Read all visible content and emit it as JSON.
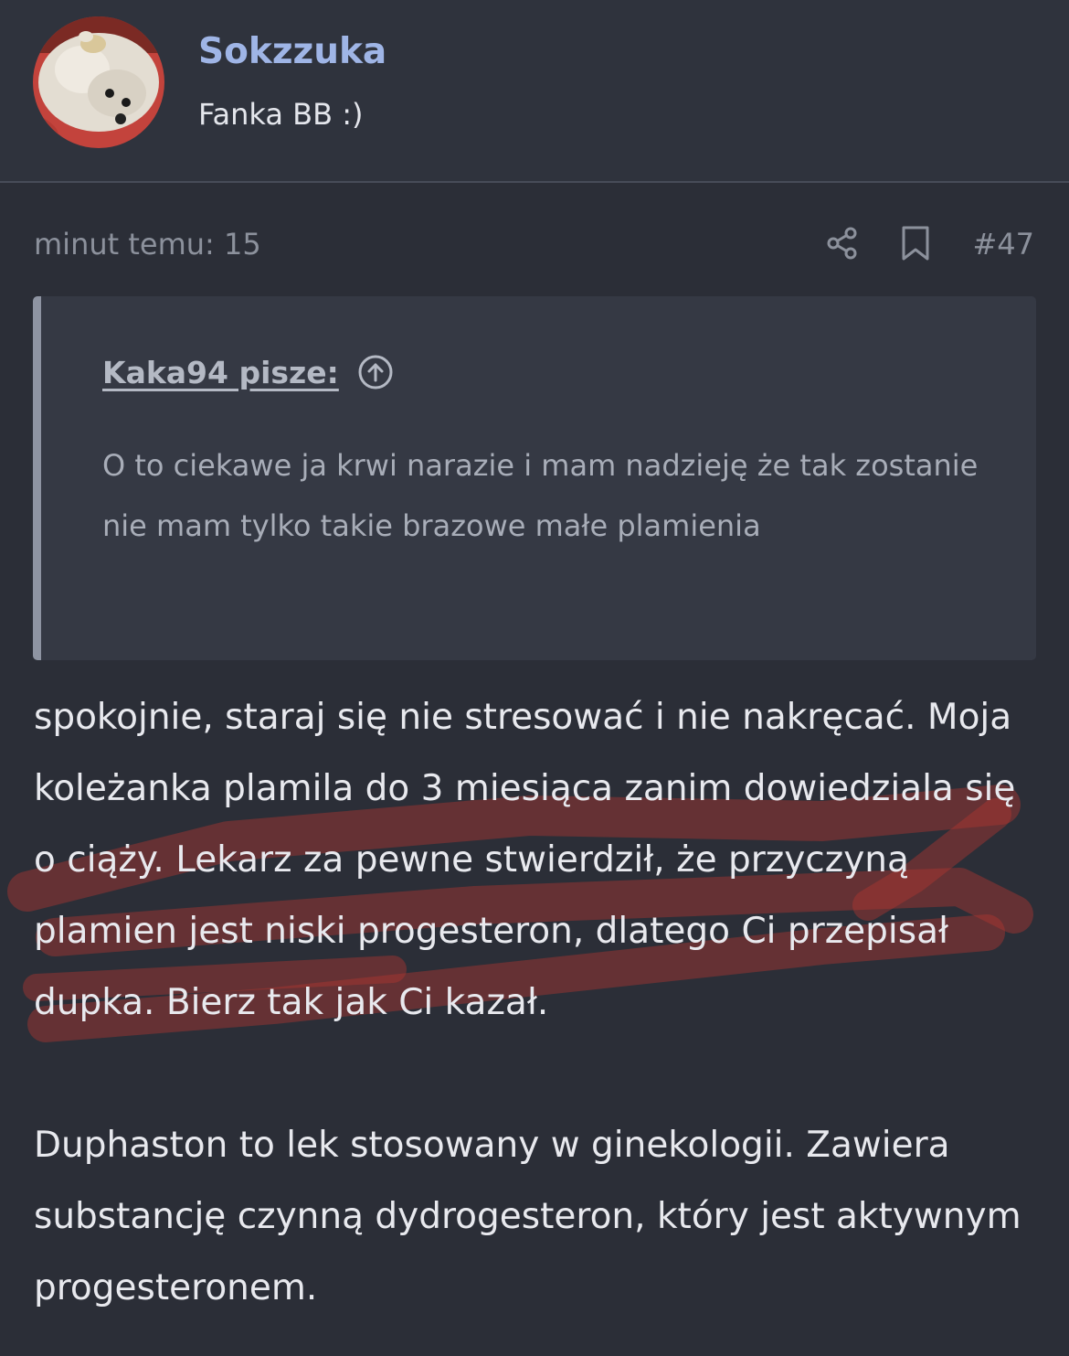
{
  "author": {
    "username": "Sokzzuka",
    "title": "Fanka BB :)",
    "avatar_icon": "dog-avatar-icon"
  },
  "post": {
    "timestamp": "minut temu: 15",
    "number": "#47",
    "share_icon": "share-icon",
    "bookmark_icon": "bookmark-icon"
  },
  "quote": {
    "author": "Kaka94 pisze:",
    "arrow_icon": "arrow-up-circle-icon",
    "text": "O to ciekawe ja krwi narazie i mam nadzieję że tak zostanie nie mam tylko takie brazowe małe plamienia"
  },
  "body": {
    "paragraph1": "spokojnie, staraj się nie stresować i nie nakręcać. Moja koleżanka plamila do 3 miesiąca zanim dowiedziala się o ciąży. Lekarz za pewne stwierdził, że przyczyną plamien jest niski progesteron, dlatego Ci przepisał dupka. Bierz tak jak Ci kazał.",
    "paragraph2": "Duphaston to lek stosowany w ginekologii. Zawiera substancję czynną dydrogesteron, który jest aktywnym progesteronem."
  },
  "colors": {
    "background": "#2b2e37",
    "username": "#9fb5e6",
    "quote_bg": "#353944",
    "scribble": "#b5362f"
  }
}
